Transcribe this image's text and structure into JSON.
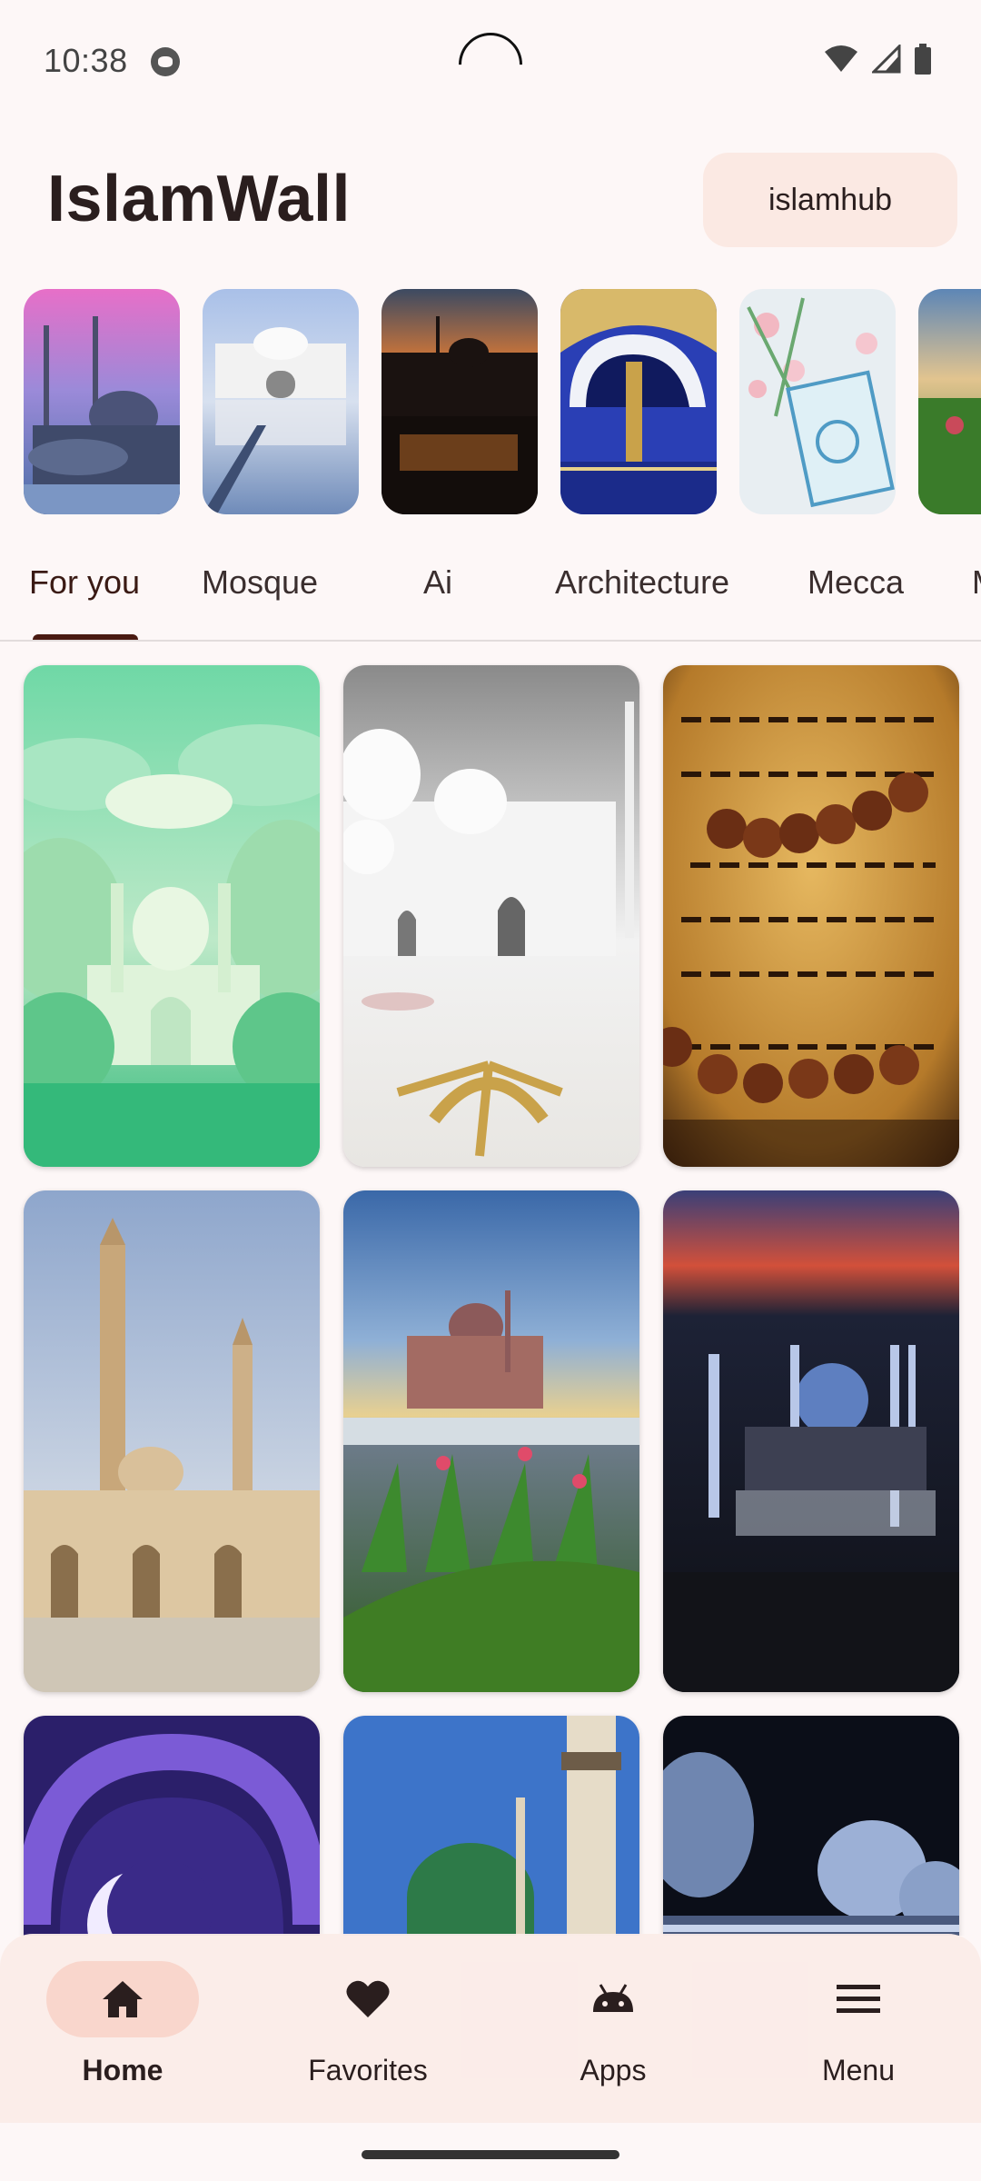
{
  "status_bar": {
    "time": "10:38"
  },
  "header": {
    "title": "IslamWall",
    "hub_label": "islamhub"
  },
  "stories": [
    {
      "icon": "blue-mosque-sunset-thumb"
    },
    {
      "icon": "white-palace-reflection-thumb"
    },
    {
      "icon": "mosque-silhouette-dusk-thumb"
    },
    {
      "icon": "golden-arches-thumb"
    },
    {
      "icon": "quran-flowers-thumb"
    },
    {
      "icon": "mosque-garden-thumb"
    }
  ],
  "tabs": [
    {
      "label": "For you",
      "active": true
    },
    {
      "label": "Mosque"
    },
    {
      "label": "Ai"
    },
    {
      "label": "Architecture"
    },
    {
      "label": "Mecca"
    },
    {
      "label": "M"
    }
  ],
  "wallpapers": [
    {
      "icon": "green-paper-mosque-image"
    },
    {
      "icon": "white-marble-mosque-image"
    },
    {
      "icon": "quran-prayer-beads-image"
    },
    {
      "icon": "minaret-plaza-image"
    },
    {
      "icon": "pink-mosque-garden-image"
    },
    {
      "icon": "night-city-mosque-image"
    },
    {
      "icon": "crescent-arch-image"
    },
    {
      "icon": "green-dome-medina-image"
    },
    {
      "icon": "white-domes-night-image"
    }
  ],
  "bottom_nav": {
    "items": [
      {
        "label": "Home",
        "icon": "home-icon",
        "active": true
      },
      {
        "label": "Favorites",
        "icon": "heart-icon"
      },
      {
        "label": "Apps",
        "icon": "android-icon"
      },
      {
        "label": "Menu",
        "icon": "hamburger-menu-icon"
      }
    ]
  },
  "colors": {
    "background": "#fdf7f7",
    "accent_pill": "#f9d6cc",
    "hub_button": "#fbe9e3",
    "tab_indicator": "#4a1a12"
  }
}
